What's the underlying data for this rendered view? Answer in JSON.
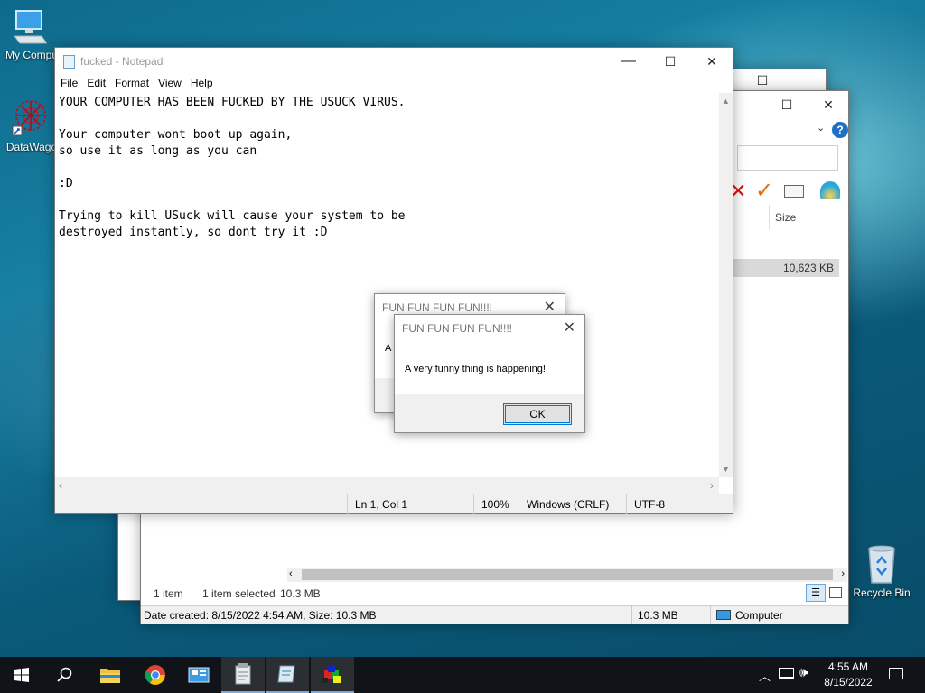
{
  "desktop": {
    "icons": [
      {
        "label": "My Compu"
      },
      {
        "label": "DataWago"
      },
      {
        "label": "Recycle Bin"
      }
    ]
  },
  "explorer": {
    "column_size": "Size",
    "file_size": "10,623 KB",
    "status_items": "1 item",
    "status_selected": "1 item selected",
    "status_selected_size": "10.3 MB",
    "details_text": "Date created: 8/15/2022 4:54 AM, Size: 10.3 MB",
    "details_size": "10.3 MB",
    "details_location": "Computer"
  },
  "notepad": {
    "title": "fucked - Notepad",
    "menu": [
      "File",
      "Edit",
      "Format",
      "View",
      "Help"
    ],
    "content": "YOUR COMPUTER HAS BEEN FUCKED BY THE USUCK VIRUS.\n\nYour computer wont boot up again,\nso use it as long as you can\n\n:D\n\nTrying to kill USuck will cause your system to be\ndestroyed instantly, so dont try it :D",
    "status": {
      "position": "Ln 1, Col 1",
      "zoom": "100%",
      "line_ending": "Windows (CRLF)",
      "encoding": "UTF-8"
    }
  },
  "dialog_back": {
    "title": "FUN FUN FUN FUN!!!!",
    "message_partial": "A v"
  },
  "dialog_front": {
    "title": "FUN FUN FUN FUN!!!!",
    "message": "A very funny thing is happening!",
    "ok_label": "OK"
  },
  "taskbar": {
    "time": "4:55 AM",
    "date": "8/15/2022"
  },
  "colors": {
    "accent": "#0078d7",
    "taskbar": "#101418"
  }
}
